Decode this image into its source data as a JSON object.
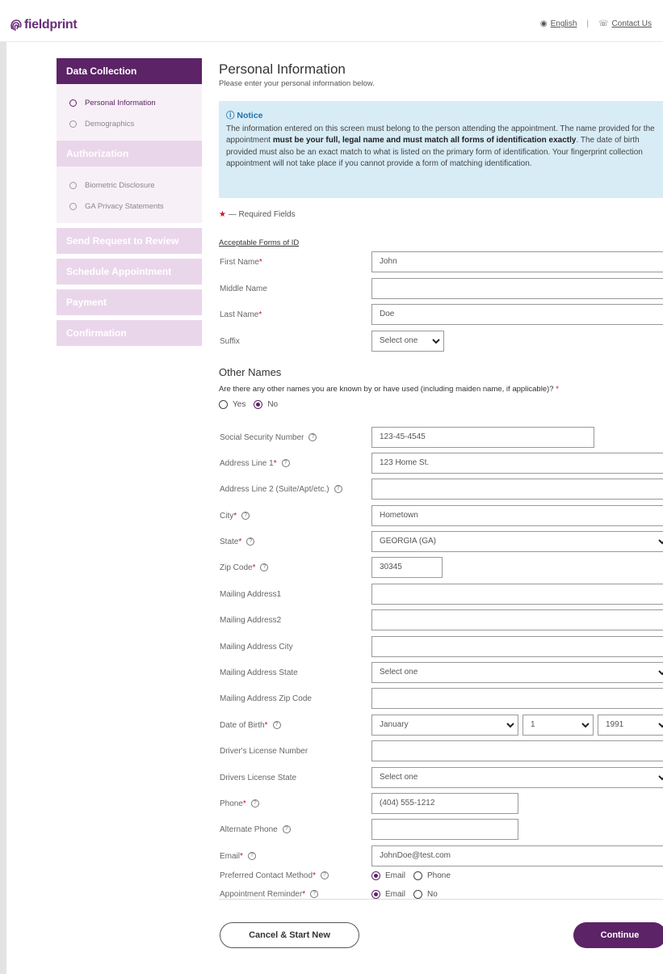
{
  "header": {
    "logo_text": "fieldprint",
    "language_link": "English",
    "contact_link": "Contact Us"
  },
  "sidebar": {
    "data_collection": "Data Collection",
    "personal_information": "Personal Information",
    "demographics": "Demographics",
    "authorization": "Authorization",
    "biometric_disclosure": "Biometric Disclosure",
    "ga_privacy": "GA Privacy Statements",
    "send_request": "Send Request to Review",
    "schedule": "Schedule Appointment",
    "payment": "Payment",
    "confirmation": "Confirmation"
  },
  "page": {
    "title": "Personal Information",
    "subtitle": "Please enter your personal information below."
  },
  "notice": {
    "title": "Notice",
    "text_1": "The information entered on this screen must belong to the person attending the appointment. The name provided for the appointment ",
    "bold_1": "must be your full, legal name and must match all forms of identification exactly",
    "text_2": ". The date of birth provided must also be an exact match to what is listed on the primary form of identification. Your fingerprint collection appointment will not take place if you cannot provide a form of matching identification."
  },
  "required_note": "— Required Fields",
  "acceptable_id_link": "Acceptable Forms of ID",
  "fields": {
    "first_name": {
      "label": "First Name",
      "value": "John"
    },
    "middle_name": {
      "label": "Middle Name",
      "value": ""
    },
    "last_name": {
      "label": "Last Name",
      "value": "Doe"
    },
    "suffix": {
      "label": "Suffix",
      "value": "Select one"
    },
    "ssn": {
      "label": "Social Security Number",
      "value": "123-45-4545"
    },
    "address1": {
      "label": "Address Line 1",
      "value": "123 Home St."
    },
    "address2": {
      "label": "Address Line 2 (Suite/Apt/etc.)",
      "value": ""
    },
    "city": {
      "label": "City",
      "value": "Hometown"
    },
    "state": {
      "label": "State",
      "value": "GEORGIA (GA)"
    },
    "zip": {
      "label": "Zip Code",
      "value": "30345"
    },
    "mail1": {
      "label": "Mailing Address1",
      "value": ""
    },
    "mail2": {
      "label": "Mailing Address2",
      "value": ""
    },
    "mail_city": {
      "label": "Mailing Address City",
      "value": ""
    },
    "mail_state": {
      "label": "Mailing Address State",
      "value": "Select one"
    },
    "mail_zip": {
      "label": "Mailing Address Zip Code",
      "value": ""
    },
    "dob": {
      "label": "Date of Birth",
      "month": "January",
      "day": "1",
      "year": "1991"
    },
    "dl_number": {
      "label": "Driver's License Number",
      "value": ""
    },
    "dl_state": {
      "label": "Drivers License State",
      "value": "Select one"
    },
    "phone": {
      "label": "Phone",
      "value": "(404) 555-1212"
    },
    "alt_phone": {
      "label": "Alternate Phone",
      "value": ""
    },
    "email": {
      "label": "Email",
      "value": "JohnDoe@test.com"
    },
    "contact_method": {
      "label": "Preferred Contact Method",
      "opt1": "Email",
      "opt2": "Phone",
      "selected": "Email"
    },
    "reminder": {
      "label": "Appointment Reminder",
      "opt1": "Email",
      "opt2": "No",
      "selected": "Email"
    }
  },
  "other_names": {
    "heading": "Other Names",
    "question": "Are there any other names you are known by or have used (including maiden name, if applicable)?",
    "yes": "Yes",
    "no": "No",
    "selected": "No"
  },
  "buttons": {
    "cancel": "Cancel & Start New",
    "continue": "Continue"
  },
  "colors": {
    "brand": "#5c2366",
    "notice_bg": "#d8ecf6",
    "required": "#c8102e"
  }
}
